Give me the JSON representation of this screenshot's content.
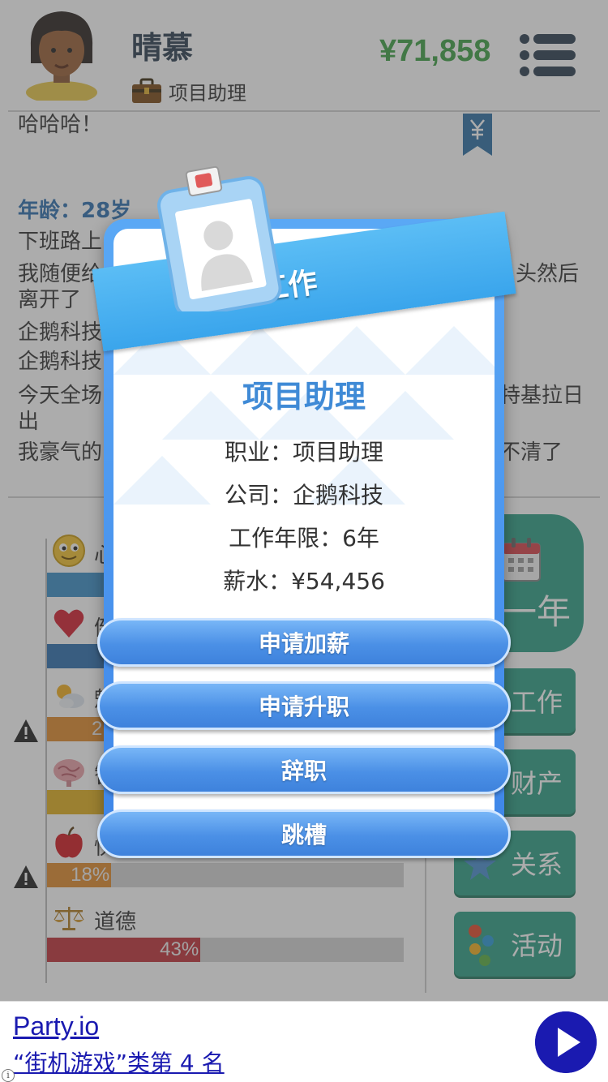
{
  "header": {
    "name": "晴慕",
    "job": "项目助理",
    "money": "¥71,858"
  },
  "log": {
    "lines": [
      "哈哈哈！",
      "年龄：28岁",
      "下班路上",
      "我随便给",
      "离开了",
      "企鹅科技",
      "企鹅科技",
      "今天全场",
      "出",
      "我豪气的"
    ],
    "right_fragments": [
      "头然后",
      "特基拉日",
      "不清了"
    ]
  },
  "stats": [
    {
      "label": "心",
      "icon": "smiley-icon",
      "value": "",
      "percent": 16,
      "color": "#3b8fc7",
      "warn": false
    },
    {
      "label": "健",
      "icon": "heart-icon",
      "value": "",
      "percent": 16,
      "color": "#2f6fb0",
      "warn": false
    },
    {
      "label": "魅",
      "icon": "weather-icon",
      "value": "2",
      "percent": 16,
      "color": "#e08a2c",
      "warn": true
    },
    {
      "label": "智",
      "icon": "brain-icon",
      "value": "",
      "percent": 16,
      "color": "#e0b020",
      "warn": false
    },
    {
      "label": "快",
      "icon": "apple-icon",
      "value": "18%",
      "percent": 18,
      "color": "#e08a2c",
      "warn": true
    },
    {
      "label": "道德",
      "icon": "scales-icon",
      "value": "43%",
      "percent": 43,
      "color": "#c0323a",
      "warn": false
    }
  ],
  "side": {
    "next_year": "一年",
    "buttons": [
      "工作",
      "财产",
      "关系",
      "活动"
    ]
  },
  "modal": {
    "ribbon": "工作",
    "job_title": "项目助理",
    "occupation": "职业：项目助理",
    "company": "公司：企鹅科技",
    "years": "工作年限：6年",
    "salary": "薪水：¥54,456",
    "buttons": [
      "申请加薪",
      "申请升职",
      "辞职",
      "跳槽"
    ]
  },
  "ad": {
    "title": "Party.io",
    "subtitle": "“街机游戏”类第 4 名",
    "info": "i"
  },
  "colors": {
    "money": "#3fa046",
    "accent_blue": "#3f8ad6",
    "side_button": "#2f9e86",
    "ad_link": "#1a1ab0"
  }
}
